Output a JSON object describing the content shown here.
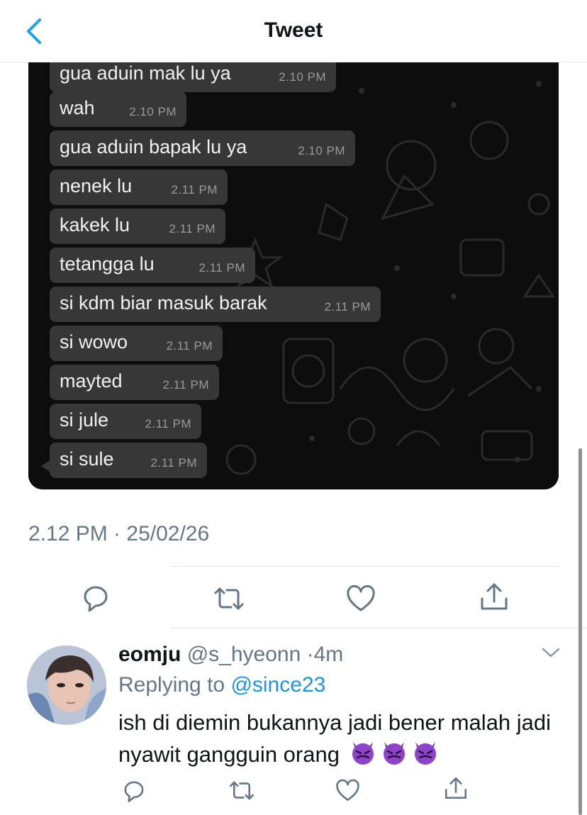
{
  "header": {
    "title": "Tweet"
  },
  "chat": {
    "messages": [
      {
        "text": "gua aduin mak lu ya",
        "time": "2.10 PM"
      },
      {
        "text": "wah",
        "time": "2.10 PM"
      },
      {
        "text": "gua aduin bapak lu ya",
        "time": "2.10 PM"
      },
      {
        "text": "nenek lu",
        "time": "2.11 PM"
      },
      {
        "text": "kakek lu",
        "time": "2.11 PM"
      },
      {
        "text": "tetangga lu",
        "time": "2.11 PM"
      },
      {
        "text": "si kdm biar masuk barak",
        "time": "2.11 PM"
      },
      {
        "text": "si wowo",
        "time": "2.11 PM"
      },
      {
        "text": "mayted",
        "time": "2.11 PM"
      },
      {
        "text": "si jule",
        "time": "2.11 PM"
      },
      {
        "text": "si sule",
        "time": "2.11 PM"
      }
    ]
  },
  "tweet": {
    "timestamp": "2.12 PM · 25/02/26"
  },
  "actions": [
    "reply-icon",
    "retweet-icon",
    "like-icon",
    "share-icon"
  ],
  "reply": {
    "name": "eomju",
    "handle": "@s_hyeonn",
    "sep": "·",
    "time": "4m",
    "replying_prefix": "Replying to ",
    "replying_to": "@since23",
    "text": "ish di diemin bukannya jadi bener malah jadi nyawit gangguin orang",
    "emoji": "smiling-face-with-horns-purple"
  },
  "colors": {
    "accent": "#1b95e0",
    "back_arrow": "#1da1f2",
    "muted": "#657786",
    "chat_bubble": "#373737",
    "chat_bg": "#0d0d0d",
    "emoji_purple": "#8e44c9"
  }
}
